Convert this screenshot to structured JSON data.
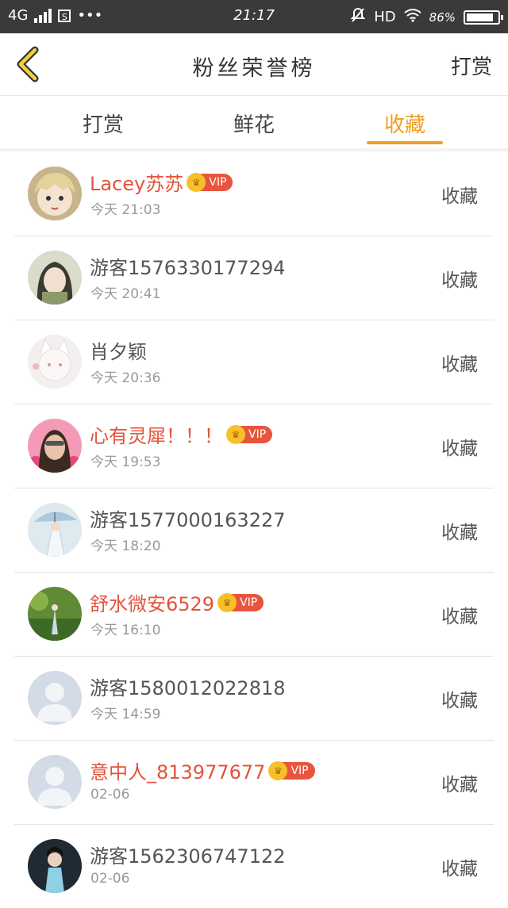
{
  "status_bar": {
    "network": "4G",
    "sim_label": "S",
    "more": "•••",
    "time": "21:17",
    "hd": "HD",
    "battery": "86%",
    "battery_level": 0.86
  },
  "header": {
    "title": "粉丝荣誉榜",
    "right_label": "打赏"
  },
  "tabs": [
    {
      "label": "打赏",
      "active": false
    },
    {
      "label": "鲜花",
      "active": false
    },
    {
      "label": "收藏",
      "active": true
    }
  ],
  "colors": {
    "accent": "#f0a020",
    "vip_name": "#e4533b",
    "vip_badge": "#e8543e"
  },
  "badge_text": "VIP",
  "entries": [
    {
      "name": "Lacey苏苏",
      "time": "今天 21:03",
      "action": "收藏",
      "vip": true,
      "avatar": "anime-girl-avatar"
    },
    {
      "name": "游客1576330177294",
      "time": "今天 20:41",
      "action": "收藏",
      "vip": false,
      "avatar": "anime-dark-hair-avatar"
    },
    {
      "name": "肖夕颖",
      "time": "今天 20:36",
      "action": "收藏",
      "vip": false,
      "avatar": "white-fox-girl-avatar"
    },
    {
      "name": "心有灵犀！！！",
      "time": "今天 19:53",
      "action": "收藏",
      "vip": true,
      "avatar": "flower-portrait-avatar"
    },
    {
      "name": "游客1577000163227",
      "time": "今天 18:20",
      "action": "收藏",
      "vip": false,
      "avatar": "umbrella-figure-avatar"
    },
    {
      "name": "舒水微安6529",
      "time": "今天 16:10",
      "action": "收藏",
      "vip": true,
      "avatar": "green-scene-avatar"
    },
    {
      "name": "游客1580012022818",
      "time": "今天 14:59",
      "action": "收藏",
      "vip": false,
      "avatar": "default-user-avatar"
    },
    {
      "name": "意中人_813977677",
      "time": "02-06",
      "action": "收藏",
      "vip": true,
      "avatar": "default-user-avatar"
    },
    {
      "name": "游客1562306747122",
      "time": "02-06",
      "action": "收藏",
      "vip": false,
      "avatar": "dark-costume-avatar"
    }
  ]
}
